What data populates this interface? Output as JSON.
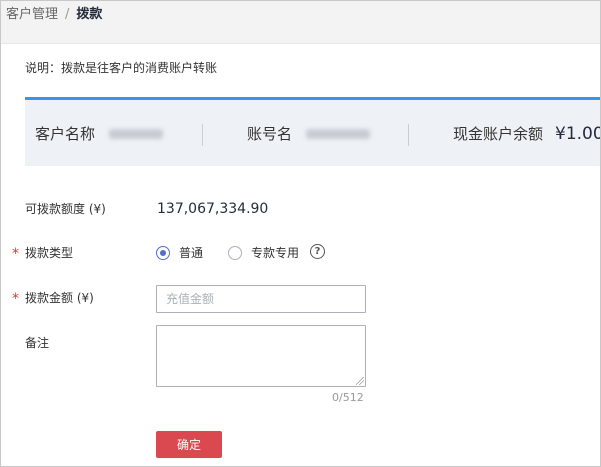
{
  "breadcrumb": {
    "parent": "客户管理",
    "separator": "/",
    "current": "拨款"
  },
  "description": "说明：拨款是往客户的消费账户转账",
  "info": {
    "customer_name_label": "客户名称",
    "account_name_label": "账号名",
    "cash_balance_label": "现金账户余额",
    "cash_balance_value": "¥1.00"
  },
  "form": {
    "available_label": "可拨款额度 (¥)",
    "available_value": "137,067,334.90",
    "type_label": "拨款类型",
    "type_options": [
      "普通",
      "专款专用"
    ],
    "type_selected": "普通",
    "amount_label": "拨款金额 (¥)",
    "amount_placeholder": "充值金额",
    "remark_label": "备注",
    "remark_value": "",
    "remark_counter": "0/512",
    "submit_label": "确定"
  },
  "colors": {
    "accent_blue": "#3399e6",
    "radio_blue": "#526ecc",
    "submit_red": "#d9494f",
    "required_red": "#e5352c"
  },
  "icons": {
    "help": "question-circle-icon"
  }
}
